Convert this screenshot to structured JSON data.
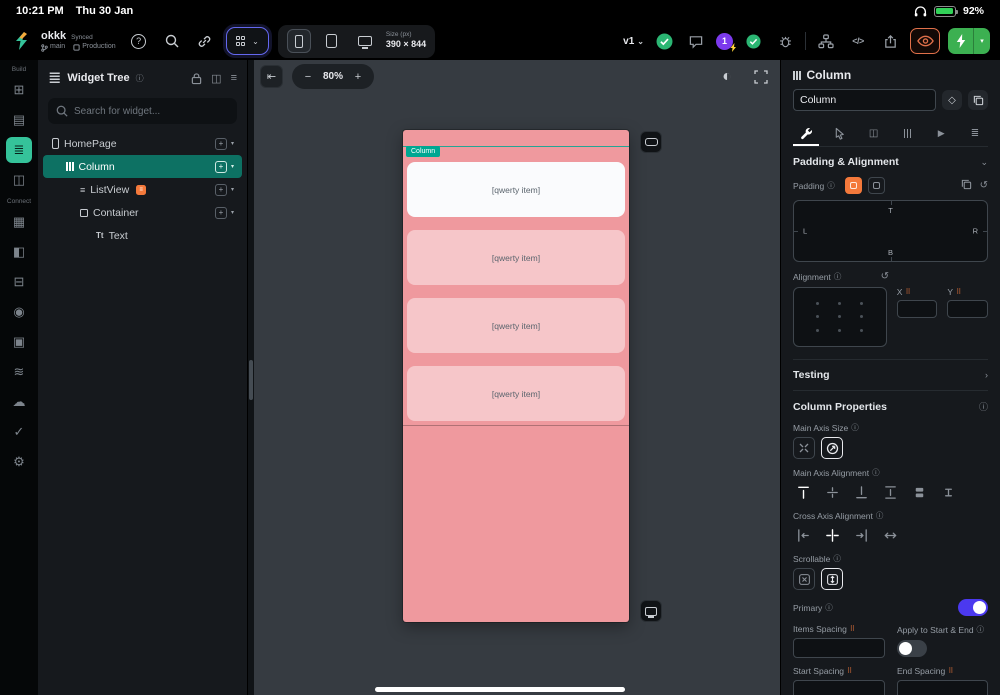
{
  "status_bar": {
    "time": "10:21 PM",
    "date": "Thu 30 Jan",
    "battery": "92%"
  },
  "toolbar": {
    "project_name": "okkk",
    "sync_status": "Synced",
    "branch": "main",
    "environment": "Production",
    "size_label": "Size (px)",
    "size_value": "390 × 844",
    "version": "v1",
    "notification_count": "1",
    "code_icon": "</>"
  },
  "nav_rail": {
    "build_label": "Build",
    "connect_label": "Connect"
  },
  "widget_tree": {
    "title": "Widget Tree",
    "search_placeholder": "Search for widget...",
    "items": [
      {
        "label": "HomePage"
      },
      {
        "label": "Column"
      },
      {
        "label": "ListView"
      },
      {
        "label": "Container"
      },
      {
        "label": "Text"
      }
    ]
  },
  "canvas": {
    "zoom": "80%",
    "selection_tag": "Column",
    "list_items": [
      "[qwerty item]",
      "[qwerty item]",
      "[qwerty item]",
      "[qwerty item]"
    ]
  },
  "properties": {
    "widget_type": "Column",
    "name_value": "Column",
    "padding_alignment_section": "Padding & Alignment",
    "padding_label": "Padding",
    "sides": {
      "t": "T",
      "l": "L",
      "r": "R",
      "b": "B"
    },
    "alignment_label": "Alignment",
    "x_label": "X",
    "y_label": "Y",
    "x_value": "",
    "y_value": "",
    "testing_section": "Testing",
    "column_properties_section": "Column Properties",
    "main_axis_size_label": "Main Axis Size",
    "main_axis_alignment_label": "Main Axis Alignment",
    "cross_axis_alignment_label": "Cross Axis Alignment",
    "scrollable_label": "Scrollable",
    "primary_label": "Primary",
    "items_spacing_label": "Items Spacing",
    "items_spacing_value": "",
    "apply_start_end_label": "Apply to Start & End",
    "start_spacing_label": "Start Spacing",
    "start_spacing_value": "",
    "end_spacing_label": "End Spacing",
    "end_spacing_value": ""
  },
  "icons": {
    "collapse": "⇤",
    "minus": "−",
    "plus": "+",
    "caret": "▾",
    "chevron_down": "⌄",
    "chevron_right": "›",
    "info": "ⓘ",
    "reset": "↺",
    "theme": "◐",
    "braille": "⠿",
    "help": "?",
    "diamond": "◇",
    "list": "≡",
    "panel": "◫",
    "options": "≡",
    "play": "▶",
    "doc": "≣",
    "text_widget": "Tt",
    "add_widget": "⊞",
    "pages": "▤",
    "tree": "≣",
    "components": "◫",
    "database": "▦",
    "schema": "◧",
    "content": "⊟",
    "users": "◉",
    "media": "▣",
    "flows": "≋",
    "cloud": "☁",
    "checks": "✓",
    "settings": "⚙"
  },
  "colors": {
    "selection_teal": "#00A792",
    "tree_selected_bg": "#0D7163",
    "rail_selected_green": "#35C39A",
    "accent_orange": "#F4793B",
    "primary_blue": "#4B39EF",
    "run_green": "#3CB051",
    "canvas_pink": "#EF999E",
    "item_pink": "#F6C6C9",
    "item_white": "#FAFBFD",
    "eye_orange": "#E0704A",
    "badge_purple": "#7C3AED",
    "check_green": "#2BB673"
  }
}
